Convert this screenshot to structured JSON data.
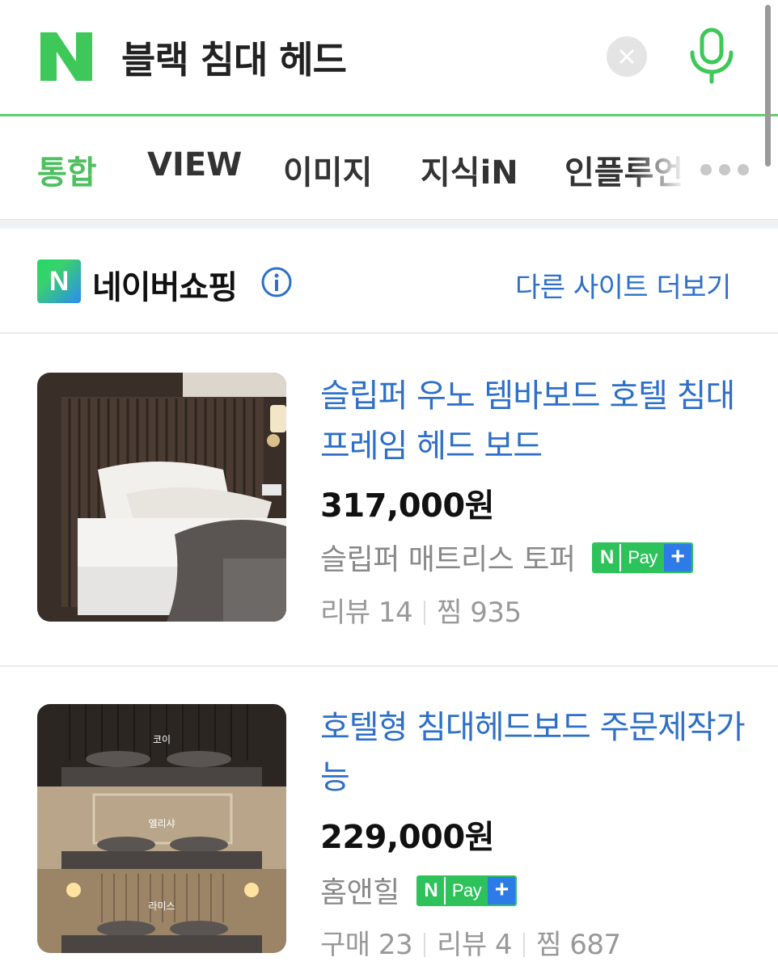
{
  "search": {
    "query": "블랙 침대 헤드",
    "logo_icon": "naver-n-logo",
    "clear_icon": "close-icon",
    "mic_icon": "microphone-icon",
    "accent_color": "#5fcf6f"
  },
  "tabs": [
    {
      "label": "통합",
      "active": true
    },
    {
      "label": "VIEW",
      "active": false
    },
    {
      "label": "이미지",
      "active": false
    },
    {
      "label": "지식iN",
      "active": false
    },
    {
      "label": "인플루언",
      "active": false
    }
  ],
  "tabs_more_icon": "more-dots-icon",
  "shopping": {
    "logo_letter": "N",
    "title": "네이버쇼핑",
    "info_icon": "info-icon",
    "more_link": "다른 사이트 더보기",
    "link_color": "#2d6fc9"
  },
  "products": [
    {
      "title": "슬립퍼 우노 템바보드 호텔 침대 프레임 헤드 보드",
      "price": "317,000원",
      "seller": "슬립퍼 매트리스 토퍼",
      "npay": {
        "n": "N",
        "pay": "Pay",
        "plus": "+"
      },
      "stats": [
        "리뷰 14",
        "찜 935"
      ]
    },
    {
      "title": "호텔형 침대헤드보드 주문제작가능",
      "price": "229,000원",
      "seller": "홈앤힐",
      "npay": {
        "n": "N",
        "pay": "Pay",
        "plus": "+"
      },
      "stats": [
        "구매 23",
        "리뷰 4",
        "찜 687"
      ],
      "image_labels": [
        "코이",
        "엘리샤",
        "라미스"
      ]
    }
  ]
}
